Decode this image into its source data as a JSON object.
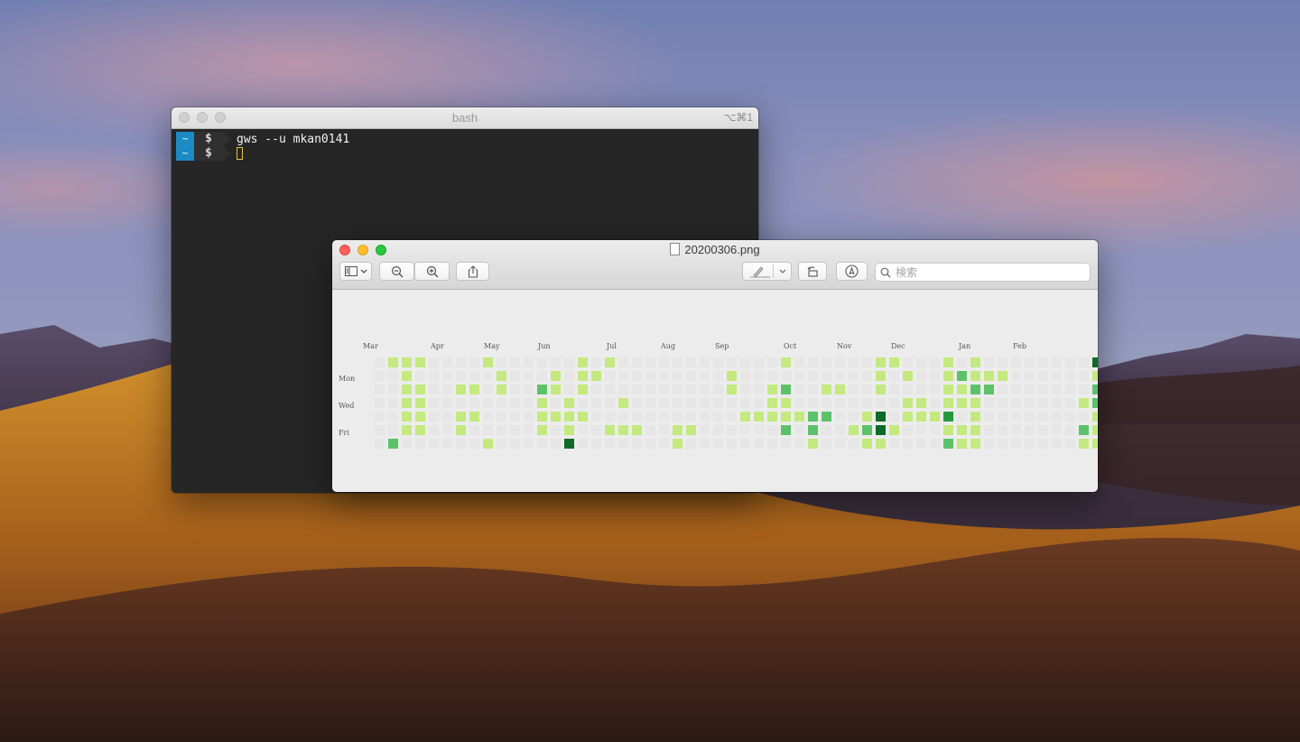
{
  "terminal": {
    "title": "bash",
    "shortcut": "⌥⌘1",
    "lines": [
      {
        "prompt_dir": "~",
        "prompt_sym": "$",
        "command": "gws --u mkan0141"
      },
      {
        "prompt_dir": "~",
        "prompt_sym": "$",
        "command": ""
      }
    ]
  },
  "preview": {
    "title": "20200306.png",
    "search_placeholder": "検索",
    "icons": [
      "sidebar-icon",
      "chevron-down-icon",
      "zoom-out-icon",
      "zoom-in-icon",
      "share-icon",
      "pen-icon",
      "chevron-down-icon",
      "rotate-icon",
      "markup-icon",
      "search-icon"
    ],
    "months": [
      "Mar",
      "Apr",
      "May",
      "Jun",
      "Jul",
      "Aug",
      "Sep",
      "Oct",
      "Nov",
      "Dec",
      "Jan",
      "Feb"
    ],
    "days": [
      "Mon",
      "Wed",
      "Fri"
    ],
    "colors": {
      "empty": "#e6e6e6",
      "l1": "#c3e97f",
      "l2": "#5cc26a",
      "l3": "#259a3d",
      "l4": "#0e6a27"
    },
    "contributions": [
      [
        0,
        0,
        0,
        0,
        0,
        0,
        0
      ],
      [
        1,
        0,
        0,
        0,
        0,
        0,
        2
      ],
      [
        1,
        1,
        1,
        1,
        1,
        1,
        0
      ],
      [
        1,
        0,
        1,
        1,
        1,
        1,
        0
      ],
      [
        0,
        0,
        0,
        0,
        0,
        0,
        0
      ],
      [
        0,
        0,
        0,
        0,
        0,
        0,
        0
      ],
      [
        0,
        0,
        1,
        0,
        1,
        1,
        0
      ],
      [
        0,
        0,
        1,
        0,
        1,
        0,
        0
      ],
      [
        1,
        0,
        0,
        0,
        0,
        0,
        1
      ],
      [
        0,
        1,
        1,
        0,
        0,
        0,
        0
      ],
      [
        0,
        0,
        0,
        0,
        0,
        0,
        0
      ],
      [
        0,
        0,
        0,
        0,
        0,
        0,
        0
      ],
      [
        0,
        0,
        2,
        1,
        1,
        1,
        0
      ],
      [
        0,
        1,
        1,
        0,
        1,
        0,
        0
      ],
      [
        0,
        0,
        0,
        1,
        1,
        1,
        4
      ],
      [
        1,
        1,
        1,
        0,
        1,
        0,
        0
      ],
      [
        0,
        1,
        0,
        0,
        0,
        0,
        0
      ],
      [
        1,
        0,
        0,
        0,
        0,
        1,
        0
      ],
      [
        0,
        0,
        0,
        1,
        0,
        1,
        0
      ],
      [
        0,
        0,
        0,
        0,
        0,
        1,
        0
      ],
      [
        0,
        0,
        0,
        0,
        0,
        0,
        0
      ],
      [
        0,
        0,
        0,
        0,
        0,
        0,
        0
      ],
      [
        0,
        0,
        0,
        0,
        0,
        1,
        1
      ],
      [
        0,
        0,
        0,
        0,
        0,
        1,
        0
      ],
      [
        0,
        0,
        0,
        0,
        0,
        0,
        0
      ],
      [
        0,
        0,
        0,
        0,
        0,
        0,
        0
      ],
      [
        0,
        1,
        1,
        0,
        0,
        0,
        0
      ],
      [
        0,
        0,
        0,
        0,
        1,
        0,
        0
      ],
      [
        0,
        0,
        0,
        0,
        1,
        0,
        0
      ],
      [
        0,
        0,
        1,
        1,
        1,
        0,
        0
      ],
      [
        1,
        0,
        2,
        1,
        1,
        2,
        0
      ],
      [
        0,
        0,
        0,
        0,
        1,
        0,
        0
      ],
      [
        0,
        0,
        0,
        0,
        2,
        2,
        1
      ],
      [
        0,
        0,
        1,
        0,
        2,
        0,
        0
      ],
      [
        0,
        0,
        1,
        0,
        0,
        0,
        0
      ],
      [
        0,
        0,
        0,
        0,
        0,
        1,
        0
      ],
      [
        0,
        0,
        0,
        0,
        1,
        2,
        1
      ],
      [
        1,
        1,
        1,
        0,
        4,
        4,
        1
      ],
      [
        1,
        0,
        0,
        0,
        0,
        1,
        0
      ],
      [
        0,
        1,
        0,
        1,
        1,
        0,
        0
      ],
      [
        0,
        0,
        0,
        1,
        1,
        0,
        0
      ],
      [
        0,
        0,
        0,
        0,
        1,
        0,
        0
      ],
      [
        1,
        1,
        1,
        1,
        3,
        1,
        2
      ],
      [
        0,
        2,
        1,
        1,
        0,
        1,
        1
      ],
      [
        1,
        1,
        2,
        1,
        1,
        1,
        1
      ],
      [
        0,
        1,
        2,
        0,
        0,
        0,
        0
      ],
      [
        0,
        1,
        0,
        0,
        0,
        0,
        0
      ],
      [
        0,
        0,
        0,
        0,
        0,
        0,
        0
      ],
      [
        0,
        0,
        0,
        0,
        0,
        0,
        0
      ],
      [
        0,
        0,
        0,
        0,
        0,
        0,
        0
      ],
      [
        0,
        0,
        0,
        0,
        0,
        0,
        0
      ],
      [
        0,
        0,
        0,
        0,
        0,
        0,
        0
      ],
      [
        0,
        0,
        0,
        1,
        0,
        2,
        1
      ],
      [
        4,
        1,
        2,
        2,
        1,
        1,
        1
      ],
      [
        3,
        1,
        2,
        2,
        2,
        2,
        0
      ]
    ]
  }
}
